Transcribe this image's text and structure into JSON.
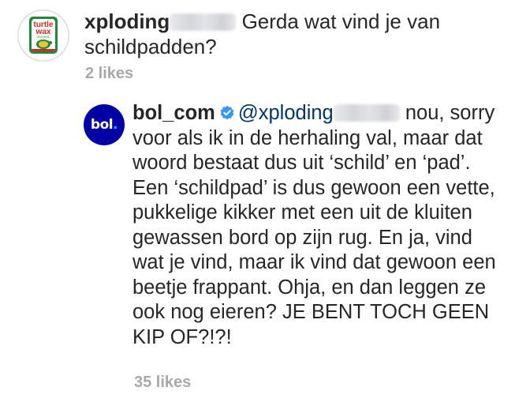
{
  "comment": {
    "username": "xploding",
    "text": "Gerda wat vind je van schildpadden?",
    "likes": "2 likes",
    "avatar": {
      "logo_top": "turtle",
      "logo_bottom": "wax",
      "logo_small": "ORIGINAL",
      "icon": "turtle-wax-logo-icon"
    }
  },
  "reply": {
    "username": "bol_com",
    "verified": true,
    "mention": "@xploding",
    "text": "nou, sorry voor als ik in de herhaling val, maar dat woord bestaat dus uit ‘schild’ en ‘pad’. Een ‘schildpad’ is dus gewoon een vette, pukkelige kikker met een uit de kluiten gewassen bord op zijn rug. En ja, vind wat je vind, maar ik vind dat gewoon een beetje frappant. Ohja, en dan leggen ze ook nog eieren? JE BENT TOCH GEEN KIP OF?!?!",
    "likes": "35 likes",
    "avatar": {
      "logo_text": "bol",
      "logo_dot": ".",
      "icon": "bol-com-logo-icon"
    }
  },
  "colors": {
    "text": "#262626",
    "meta": "#a8a8a8",
    "verified_blue": "#3897f0",
    "bol_blue": "#0000a4",
    "turtle_wax_red": "#d52b1e",
    "turtle_wax_green": "#1f8a3d"
  }
}
